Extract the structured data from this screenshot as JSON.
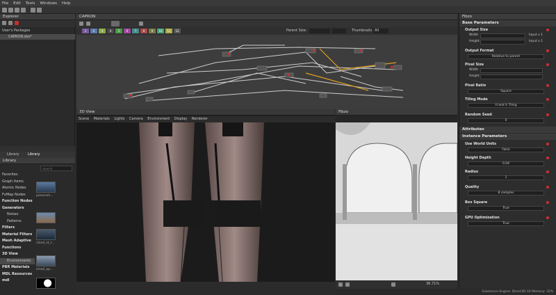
{
  "menu": [
    "File",
    "Edit",
    "Tools",
    "Windows",
    "Help"
  ],
  "explorer": {
    "title": "Explorer",
    "root": "User's Packages",
    "file": "CAPRON.sbs*"
  },
  "library": {
    "tabs": [
      "Library",
      "Library"
    ],
    "title": "Library",
    "search_placeholder": "Search",
    "categories": [
      {
        "label": "Favorites",
        "bold": false
      },
      {
        "label": "Graph Items",
        "bold": false
      },
      {
        "label": "Atomic Nodes",
        "bold": false
      },
      {
        "label": "FxMap Nodes",
        "bold": false
      },
      {
        "label": "Function Nodes",
        "bold": true
      },
      {
        "label": "Generators",
        "bold": true
      },
      {
        "label": "Noises",
        "bold": false
      },
      {
        "label": "Patterns",
        "bold": false
      },
      {
        "label": "Filters",
        "bold": true
      },
      {
        "label": "Material Filters",
        "bold": true
      },
      {
        "label": "Mesh Adaptive",
        "bold": true
      },
      {
        "label": "Functions",
        "bold": true
      },
      {
        "label": "3D View",
        "bold": true
      },
      {
        "label": "Environments",
        "bold": false
      },
      {
        "label": "PBR Materials",
        "bold": true
      },
      {
        "label": "MDL Resources",
        "bold": true
      },
      {
        "label": "mdl",
        "bold": true
      }
    ],
    "thumbs": [
      "panoram...",
      "",
      "cloud_st_l...",
      "small_ap..."
    ]
  },
  "graph": {
    "title": "CAPRON",
    "parent_size_label": "Parent Size:",
    "thumbnails_label": "Thumbnails",
    "thumbnails_value": "All",
    "swatches": [
      {
        "label": "1",
        "color": "#7a5a9a"
      },
      {
        "label": "2",
        "color": "#5a7aaa"
      },
      {
        "label": "3",
        "color": "#8aaa4a"
      },
      {
        "label": "4",
        "color": "#4a4a4a"
      },
      {
        "label": "5",
        "color": "#4a9a4a"
      },
      {
        "label": "6",
        "color": "#a04aa0"
      },
      {
        "label": "7",
        "color": "#4a8a8a"
      },
      {
        "label": "8",
        "color": "#aa4a4a"
      },
      {
        "label": "9",
        "color": "#7a7a4a"
      },
      {
        "label": "10",
        "color": "#4aa07a"
      },
      {
        "label": "11",
        "color": "#aaaa4a"
      },
      {
        "label": "12",
        "color": "#555"
      }
    ]
  },
  "view3d": {
    "title": "3D View",
    "menu": [
      "Scene",
      "Materials",
      "Lights",
      "Camera",
      "Environment",
      "Display",
      "Renderer"
    ]
  },
  "view2d": {
    "title": "Fibzo",
    "zoom": "36.71%"
  },
  "props": {
    "title": "Fibzo",
    "base_params": "Base Parameters",
    "output_size": "Output Size",
    "width": "Width",
    "height": "Height",
    "input_x1": "Input x 1",
    "output_format": "Output Format",
    "output_format_value": "Relative to parent",
    "pixel_size": "Pixel Size",
    "pixel_ratio": "Pixel Ratio",
    "pixel_ratio_value": "Square",
    "tiling_mode": "Tiling Mode",
    "tiling_value": "H and V Tiling",
    "random_seed": "Random Seed",
    "random_seed_value": "0",
    "attributes": "Attributes",
    "instance_params": "Instance Parameters",
    "use_world_units": "Use World Units",
    "false_v": "False",
    "height_depth": "Height Depth",
    "height_depth_value": "0.04",
    "radius": "Radius",
    "radius_value": "1",
    "quality": "Quality",
    "quality_value": "8 samples",
    "box_square": "Box Square",
    "true_v": "True",
    "gpu_opt": "GPU Optimization"
  },
  "status": "Substance Engine: Direct3D 10   Memory: 32%"
}
